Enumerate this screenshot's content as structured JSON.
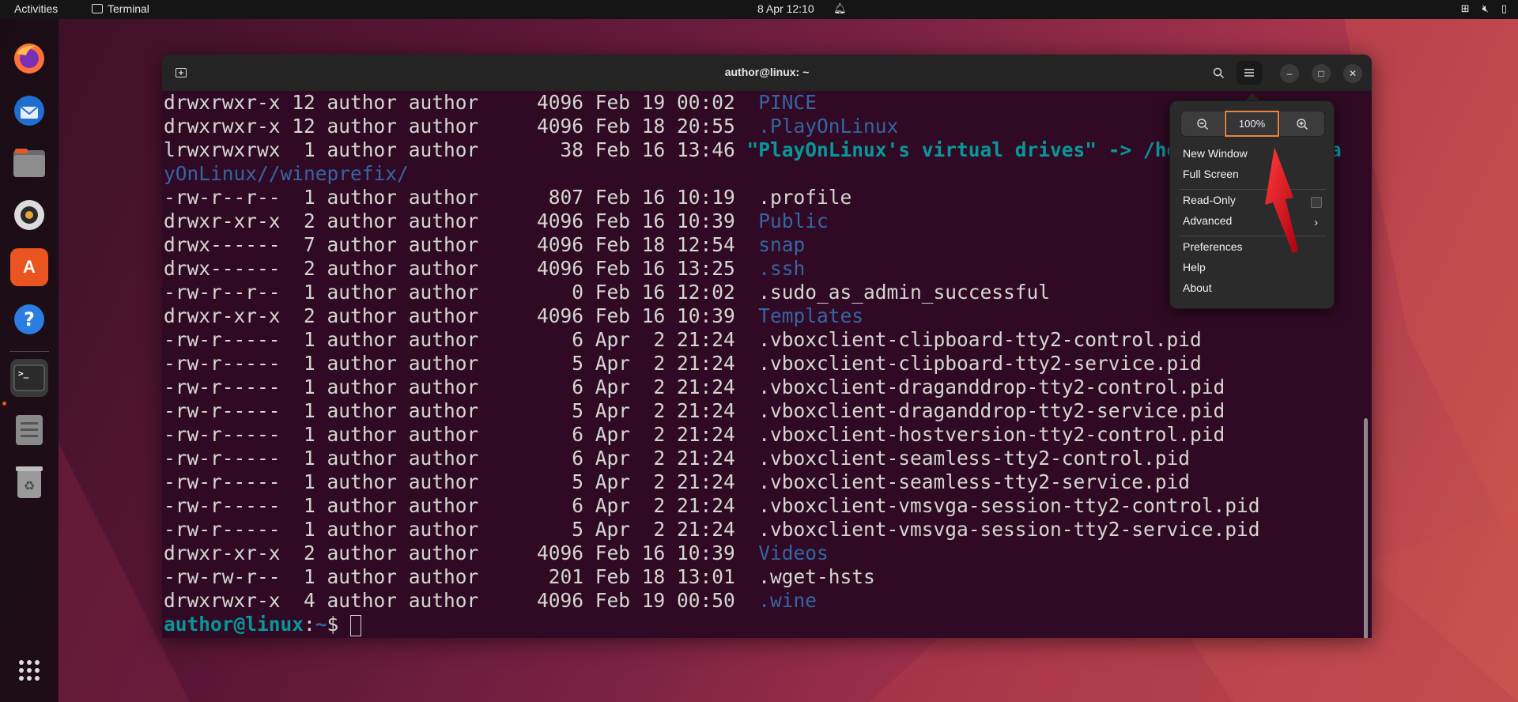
{
  "colors": {
    "accent": "#e95420",
    "terminal_bg": "#300a24",
    "dir": "#3465a4",
    "link": "#06989a"
  },
  "topbar": {
    "activities": "Activities",
    "app_name": "Terminal",
    "clock": "8 Apr  12:10"
  },
  "dock": {
    "items": [
      "firefox-icon",
      "thunderbird-icon",
      "files-icon",
      "rhythmbox-icon",
      "app-center-icon",
      "help-icon",
      "terminal-icon",
      "text-editor-icon",
      "trash-icon",
      "app-grid-icon"
    ]
  },
  "window": {
    "title": "author@linux: ~"
  },
  "terminal": {
    "lines": [
      {
        "perm": "drwxrwxr-x 12 author author     4096 Feb 19 00:02  ",
        "name": "PINCE",
        "kind": "dir"
      },
      {
        "perm": "drwxrwxr-x 12 author author     4096 Feb 18 20:55  ",
        "name": ".PlayOnLinux",
        "kind": "dir"
      },
      {
        "perm": "lrwxrwxrwx  1 author author       38 Feb 16 13:46 ",
        "name": "\"PlayOnLinux's virtual drives\" -> /home/author/.Pla",
        "kind": "sym"
      },
      {
        "perm": "",
        "name": "yOnLinux//wineprefix/",
        "kind": "dir"
      },
      {
        "perm": "-rw-r--r--  1 author author      807 Feb 16 10:19  ",
        "name": ".profile",
        "kind": "file"
      },
      {
        "perm": "drwxr-xr-x  2 author author     4096 Feb 16 10:39  ",
        "name": "Public",
        "kind": "dir"
      },
      {
        "perm": "drwx------  7 author author     4096 Feb 18 12:54  ",
        "name": "snap",
        "kind": "dir"
      },
      {
        "perm": "drwx------  2 author author     4096 Feb 16 13:25  ",
        "name": ".ssh",
        "kind": "dir"
      },
      {
        "perm": "-rw-r--r--  1 author author        0 Feb 16 12:02  ",
        "name": ".sudo_as_admin_successful",
        "kind": "file"
      },
      {
        "perm": "drwxr-xr-x  2 author author     4096 Feb 16 10:39  ",
        "name": "Templates",
        "kind": "dir"
      },
      {
        "perm": "-rw-r-----  1 author author        6 Apr  2 21:24  ",
        "name": ".vboxclient-clipboard-tty2-control.pid",
        "kind": "file"
      },
      {
        "perm": "-rw-r-----  1 author author        5 Apr  2 21:24  ",
        "name": ".vboxclient-clipboard-tty2-service.pid",
        "kind": "file"
      },
      {
        "perm": "-rw-r-----  1 author author        6 Apr  2 21:24  ",
        "name": ".vboxclient-draganddrop-tty2-control.pid",
        "kind": "file"
      },
      {
        "perm": "-rw-r-----  1 author author        5 Apr  2 21:24  ",
        "name": ".vboxclient-draganddrop-tty2-service.pid",
        "kind": "file"
      },
      {
        "perm": "-rw-r-----  1 author author        6 Apr  2 21:24  ",
        "name": ".vboxclient-hostversion-tty2-control.pid",
        "kind": "file"
      },
      {
        "perm": "-rw-r-----  1 author author        6 Apr  2 21:24  ",
        "name": ".vboxclient-seamless-tty2-control.pid",
        "kind": "file"
      },
      {
        "perm": "-rw-r-----  1 author author        5 Apr  2 21:24  ",
        "name": ".vboxclient-seamless-tty2-service.pid",
        "kind": "file"
      },
      {
        "perm": "-rw-r-----  1 author author        6 Apr  2 21:24  ",
        "name": ".vboxclient-vmsvga-session-tty2-control.pid",
        "kind": "file"
      },
      {
        "perm": "-rw-r-----  1 author author        5 Apr  2 21:24  ",
        "name": ".vboxclient-vmsvga-session-tty2-service.pid",
        "kind": "file"
      },
      {
        "perm": "drwxr-xr-x  2 author author     4096 Feb 16 10:39  ",
        "name": "Videos",
        "kind": "dir"
      },
      {
        "perm": "-rw-rw-r--  1 author author      201 Feb 18 13:01  ",
        "name": ".wget-hsts",
        "kind": "file"
      },
      {
        "perm": "drwxrwxr-x  4 author author     4096 Feb 19 00:50  ",
        "name": ".wine",
        "kind": "dir"
      }
    ],
    "prompt": {
      "user": "author@linux",
      "sep": ":",
      "path": "~",
      "symbol": "$ "
    }
  },
  "menu": {
    "zoom_value": "100%",
    "items": {
      "new_window": "New Window",
      "full_screen": "Full Screen",
      "read_only": "Read-Only",
      "advanced": "Advanced",
      "preferences": "Preferences",
      "help": "Help",
      "about": "About"
    }
  }
}
